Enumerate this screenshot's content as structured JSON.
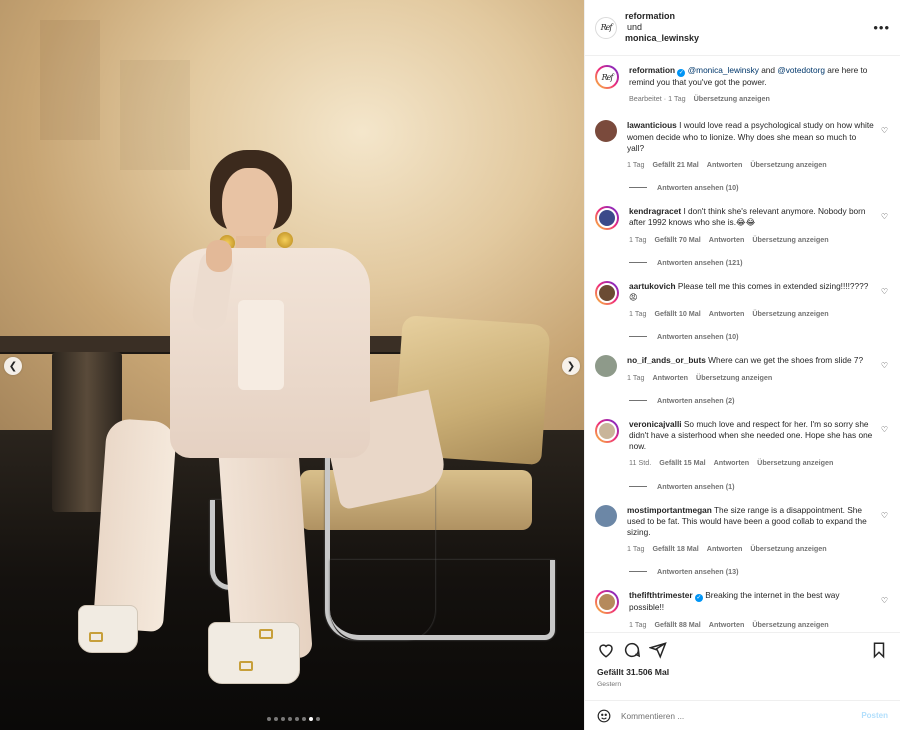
{
  "header": {
    "account": "reformation",
    "conjunction": "und",
    "coauthor": "monica_lewinsky",
    "logo_text": "Ref",
    "more_icon": "more-horizontal-icon"
  },
  "media": {
    "prev_icon": "chevron-left-icon",
    "next_icon": "chevron-right-icon",
    "slide_count": 8,
    "active_slide": 7
  },
  "caption": {
    "username": "reformation",
    "mention1": "@monica_lewinsky",
    "and": "and",
    "mention2": "@votedotorg",
    "text_after": "are here to remind you that you've got the power.",
    "edited": "Bearbeitet",
    "time": "1 Tag",
    "translate": "Übersetzung anzeigen"
  },
  "comments": [
    {
      "username": "lawanticious",
      "text": "I would love read a psychological study on how white women decide who to lionize. Why does she mean so much to yall?",
      "time": "1 Tag",
      "likes": "Gefällt 21 Mal",
      "reply": "Antworten",
      "translate": "Übersetzung anzeigen",
      "replies": "Antworten ansehen (10)",
      "avatar_color": "#7a4a3c"
    },
    {
      "username": "kendragracet",
      "text": "I don't think she's relevant anymore. Nobody born after 1992 knows who she is.😂😂",
      "time": "1 Tag",
      "likes": "Gefällt 70 Mal",
      "reply": "Antworten",
      "translate": "Übersetzung anzeigen",
      "replies": "Antworten ansehen (121)",
      "avatar_color": "#3b4a8a"
    },
    {
      "username": "aartukovich",
      "text": "Please tell me this comes in extended sizing!!!!???? 😡",
      "time": "1 Tag",
      "likes": "Gefällt 10 Mal",
      "reply": "Antworten",
      "translate": "Übersetzung anzeigen",
      "replies": "Antworten ansehen (10)",
      "avatar_color": "#6b4b33"
    },
    {
      "username": "no_if_ands_or_buts",
      "text": "Where can we get the shoes from slide 7?",
      "time": "1 Tag",
      "likes": "",
      "reply": "Antworten",
      "translate": "Übersetzung anzeigen",
      "replies": "Antworten ansehen (2)",
      "avatar_color": "#8e9a8a"
    },
    {
      "username": "veronicajvalli",
      "text": "So much love and respect for her. I'm so sorry she didn't have a sisterhood when she needed one. Hope she has one now.",
      "time": "11 Std.",
      "likes": "Gefällt 15 Mal",
      "reply": "Antworten",
      "translate": "Übersetzung anzeigen",
      "replies": "Antworten ansehen (1)",
      "avatar_color": "#c9b59a"
    },
    {
      "username": "mostimportantmegan",
      "text": "The size range is a disappointment. She used to be fat. This would have been a good collab to expand the sizing.",
      "time": "1 Tag",
      "likes": "Gefällt 18 Mal",
      "reply": "Antworten",
      "translate": "Übersetzung anzeigen",
      "replies": "Antworten ansehen (13)",
      "avatar_color": "#6c87a6"
    },
    {
      "username": "thefifthtrimester",
      "text": "Breaking the internet in the best way possible!!",
      "time": "1 Tag",
      "likes": "Gefällt 88 Mal",
      "reply": "Antworten",
      "translate": "Übersetzung anzeigen",
      "replies": "",
      "avatar_color": "#b58a5c"
    }
  ],
  "actions": {
    "like_icon": "heart-icon",
    "comment_icon": "comment-icon",
    "share_icon": "paper-plane-icon",
    "save_icon": "bookmark-icon",
    "likes": "Gefällt 31.506 Mal",
    "date": "Gestern"
  },
  "comment_box": {
    "emoji_icon": "smiley-icon",
    "placeholder": "Kommentieren ...",
    "post_label": "Posten"
  }
}
